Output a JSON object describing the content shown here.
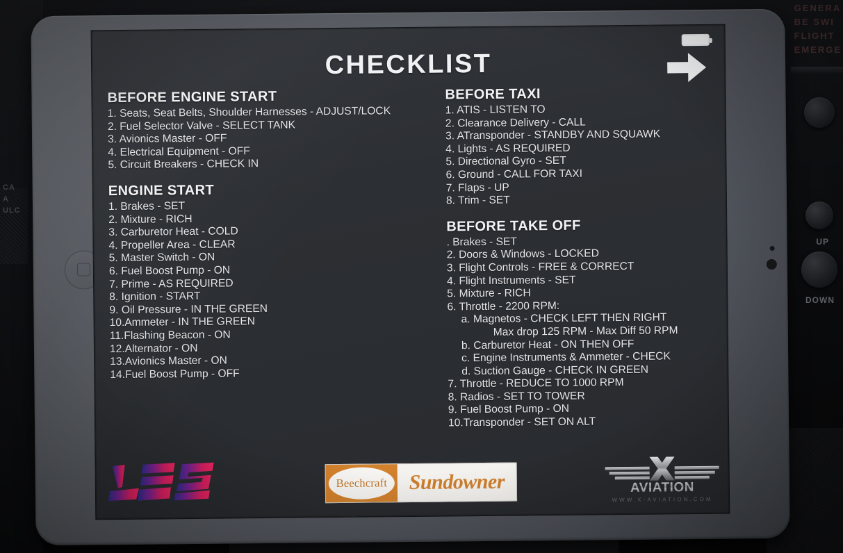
{
  "screen": {
    "title": "CHECKLIST",
    "next_label": "Next page",
    "battery_label": "Battery full"
  },
  "columns": {
    "left": [
      {
        "title": "BEFORE ENGINE START",
        "items": [
          {
            "level": 0,
            "text": "1. Seats, Seat Belts, Shoulder Harnesses - ADJUST/LOCK"
          },
          {
            "level": 0,
            "text": "2. Fuel Selector Valve - SELECT TANK"
          },
          {
            "level": 0,
            "text": "3. Avionics Master - OFF"
          },
          {
            "level": 0,
            "text": "4. Electrical Equipment - OFF"
          },
          {
            "level": 0,
            "text": "5. Circuit Breakers - CHECK IN"
          }
        ]
      },
      {
        "title": "ENGINE START",
        "items": [
          {
            "level": 0,
            "text": "1. Brakes - SET"
          },
          {
            "level": 0,
            "text": "2. Mixture - RICH"
          },
          {
            "level": 0,
            "text": "3. Carburetor Heat - COLD"
          },
          {
            "level": 0,
            "text": "4. Propeller Area - CLEAR"
          },
          {
            "level": 0,
            "text": "5. Master Switch - ON"
          },
          {
            "level": 0,
            "text": "6. Fuel Boost Pump - ON"
          },
          {
            "level": 0,
            "text": "7. Prime - AS REQUIRED"
          },
          {
            "level": 0,
            "text": "8. Ignition - START"
          },
          {
            "level": 0,
            "text": "9. Oil Pressure - IN THE GREEN"
          },
          {
            "level": 0,
            "text": "10.Ammeter - IN THE GREEN"
          },
          {
            "level": 0,
            "text": "11.Flashing Beacon - ON"
          },
          {
            "level": 0,
            "text": "12.Alternator - ON"
          },
          {
            "level": 0,
            "text": "13.Avionics Master - ON"
          },
          {
            "level": 0,
            "text": "14.Fuel Boost Pump - OFF"
          }
        ]
      }
    ],
    "right": [
      {
        "title": "BEFORE TAXI",
        "items": [
          {
            "level": 0,
            "text": "1. ATIS - LISTEN TO"
          },
          {
            "level": 0,
            "text": "2. Clearance Delivery - CALL"
          },
          {
            "level": 0,
            "text": "3. ATransponder - STANDBY AND SQUAWK"
          },
          {
            "level": 0,
            "text": "4. Lights - AS REQUIRED"
          },
          {
            "level": 0,
            "text": "5. Directional Gyro - SET"
          },
          {
            "level": 0,
            "text": "6. Ground - CALL FOR TAXI"
          },
          {
            "level": 0,
            "text": "7. Flaps - UP"
          },
          {
            "level": 0,
            "text": "8. Trim - SET"
          }
        ]
      },
      {
        "title": "BEFORE TAKE OFF",
        "items": [
          {
            "level": 0,
            "text": ". Brakes - SET"
          },
          {
            "level": 0,
            "text": "2. Doors & Windows - LOCKED"
          },
          {
            "level": 0,
            "text": "3. Flight Controls - FREE & CORRECT"
          },
          {
            "level": 0,
            "text": "4. Flight Instruments - SET"
          },
          {
            "level": 0,
            "text": "5. Mixture - RICH"
          },
          {
            "level": 0,
            "text": "6. Throttle - 2200 RPM:"
          },
          {
            "level": 1,
            "text": "a. Magnetos - CHECK LEFT THEN RIGHT"
          },
          {
            "level": 2,
            "text": "Max drop 125 RPM - Max Diff 50 RPM"
          },
          {
            "level": 1,
            "text": "b. Carburetor Heat - ON THEN OFF"
          },
          {
            "level": 1,
            "text": "c. Engine Instruments & Ammeter - CHECK"
          },
          {
            "level": 1,
            "text": "d. Suction Gauge - CHECK IN GREEN"
          },
          {
            "level": 0,
            "text": "7. Throttle - REDUCE TO 1000 RPM"
          },
          {
            "level": 0,
            "text": "8. Radios - SET TO TOWER"
          },
          {
            "level": 0,
            "text": "9. Fuel Boost Pump - ON"
          },
          {
            "level": 0,
            "text": "10.Transponder - SET ON ALT"
          }
        ]
      }
    ]
  },
  "footer": {
    "les_logo_text": "LES",
    "beechcraft_text": "Beechcraft",
    "sundowner_text": "Sundowner",
    "xaviation_mark": "X",
    "xaviation_text": "AVIATION",
    "xaviation_url": "WWW.X-AVIATION.COM"
  },
  "background": {
    "placard_text": "GENERA\nBE SWI\nFLIGHT\nEMERGE",
    "label_up": "UP",
    "label_down": "DOWN",
    "label_cabin": "CA\nA\nULC"
  },
  "colors": {
    "screen_bg": "#2c2f33",
    "text": "#e3e5e8",
    "bezel": "#5d6167",
    "accent_orange": "#cf7f2d",
    "les_blue": "#2b2d8f",
    "les_pink": "#f0255f"
  }
}
